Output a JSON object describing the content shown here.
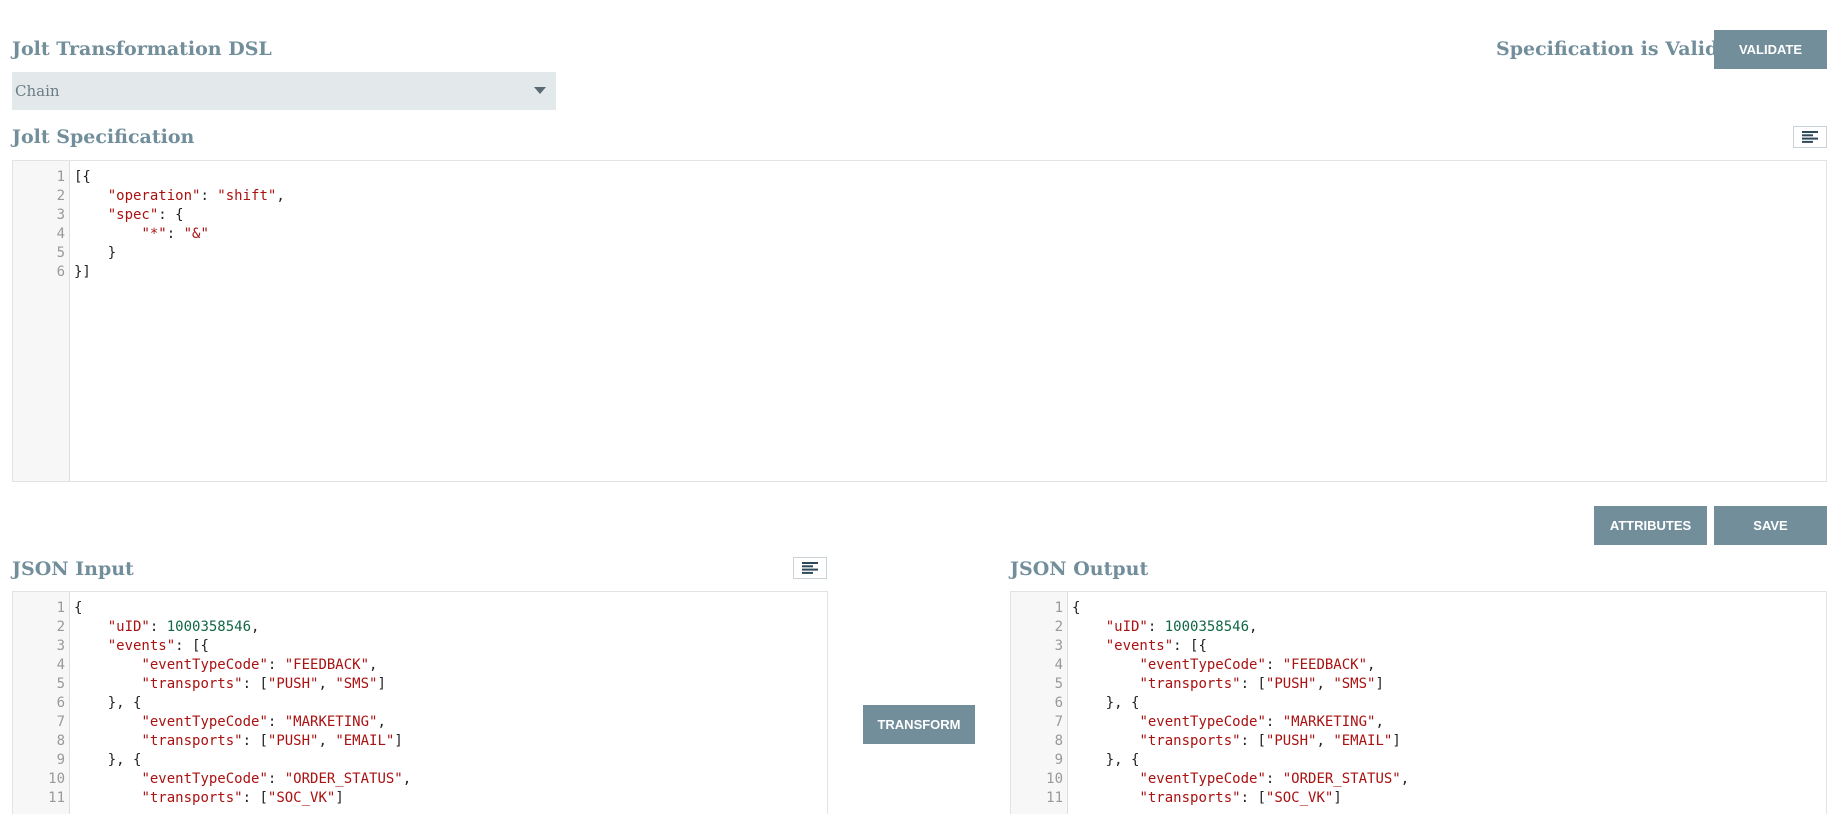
{
  "dsl": {
    "title": "Jolt Transformation DSL",
    "selected": "Chain"
  },
  "validation": {
    "status": "Specification is Valid",
    "validate_label": "VALIDATE"
  },
  "spec": {
    "title": "Jolt Specification",
    "format_icon": "format-align-icon",
    "lines": [
      [
        {
          "t": "p",
          "v": "[{"
        }
      ],
      [
        {
          "t": "p",
          "v": "    "
        },
        {
          "t": "key",
          "v": "\"operation\""
        },
        {
          "t": "p",
          "v": ": "
        },
        {
          "t": "str",
          "v": "\"shift\""
        },
        {
          "t": "p",
          "v": ","
        }
      ],
      [
        {
          "t": "p",
          "v": "    "
        },
        {
          "t": "key",
          "v": "\"spec\""
        },
        {
          "t": "p",
          "v": ": {"
        }
      ],
      [
        {
          "t": "p",
          "v": "        "
        },
        {
          "t": "key",
          "v": "\"*\""
        },
        {
          "t": "p",
          "v": ": "
        },
        {
          "t": "str",
          "v": "\"&\""
        }
      ],
      [
        {
          "t": "p",
          "v": "    }"
        }
      ],
      [
        {
          "t": "p",
          "v": "}]"
        }
      ]
    ]
  },
  "actions": {
    "attributes_label": "ATTRIBUTES",
    "save_label": "SAVE",
    "transform_label": "TRANSFORM"
  },
  "input": {
    "title": "JSON Input",
    "format_icon": "format-align-icon",
    "lines": [
      [
        {
          "t": "p",
          "v": "{"
        }
      ],
      [
        {
          "t": "p",
          "v": "    "
        },
        {
          "t": "key",
          "v": "\"uID\""
        },
        {
          "t": "p",
          "v": ": "
        },
        {
          "t": "num",
          "v": "1000358546"
        },
        {
          "t": "p",
          "v": ","
        }
      ],
      [
        {
          "t": "p",
          "v": "    "
        },
        {
          "t": "key",
          "v": "\"events\""
        },
        {
          "t": "p",
          "v": ": [{"
        }
      ],
      [
        {
          "t": "p",
          "v": "        "
        },
        {
          "t": "key",
          "v": "\"eventTypeCode\""
        },
        {
          "t": "p",
          "v": ": "
        },
        {
          "t": "str",
          "v": "\"FEEDBACK\""
        },
        {
          "t": "p",
          "v": ","
        }
      ],
      [
        {
          "t": "p",
          "v": "        "
        },
        {
          "t": "key",
          "v": "\"transports\""
        },
        {
          "t": "p",
          "v": ": ["
        },
        {
          "t": "str",
          "v": "\"PUSH\""
        },
        {
          "t": "p",
          "v": ", "
        },
        {
          "t": "str",
          "v": "\"SMS\""
        },
        {
          "t": "p",
          "v": "]"
        }
      ],
      [
        {
          "t": "p",
          "v": "    }, {"
        }
      ],
      [
        {
          "t": "p",
          "v": "        "
        },
        {
          "t": "key",
          "v": "\"eventTypeCode\""
        },
        {
          "t": "p",
          "v": ": "
        },
        {
          "t": "str",
          "v": "\"MARKETING\""
        },
        {
          "t": "p",
          "v": ","
        }
      ],
      [
        {
          "t": "p",
          "v": "        "
        },
        {
          "t": "key",
          "v": "\"transports\""
        },
        {
          "t": "p",
          "v": ": ["
        },
        {
          "t": "str",
          "v": "\"PUSH\""
        },
        {
          "t": "p",
          "v": ", "
        },
        {
          "t": "str",
          "v": "\"EMAIL\""
        },
        {
          "t": "p",
          "v": "]"
        }
      ],
      [
        {
          "t": "p",
          "v": "    }, {"
        }
      ],
      [
        {
          "t": "p",
          "v": "        "
        },
        {
          "t": "key",
          "v": "\"eventTypeCode\""
        },
        {
          "t": "p",
          "v": ": "
        },
        {
          "t": "str",
          "v": "\"ORDER_STATUS\""
        },
        {
          "t": "p",
          "v": ","
        }
      ],
      [
        {
          "t": "p",
          "v": "        "
        },
        {
          "t": "key",
          "v": "\"transports\""
        },
        {
          "t": "p",
          "v": ": ["
        },
        {
          "t": "str",
          "v": "\"SOC_VK\""
        },
        {
          "t": "p",
          "v": "]"
        }
      ]
    ]
  },
  "output": {
    "title": "JSON Output",
    "lines": [
      [
        {
          "t": "p",
          "v": "{"
        }
      ],
      [
        {
          "t": "p",
          "v": "    "
        },
        {
          "t": "key",
          "v": "\"uID\""
        },
        {
          "t": "p",
          "v": ": "
        },
        {
          "t": "num",
          "v": "1000358546"
        },
        {
          "t": "p",
          "v": ","
        }
      ],
      [
        {
          "t": "p",
          "v": "    "
        },
        {
          "t": "key",
          "v": "\"events\""
        },
        {
          "t": "p",
          "v": ": [{"
        }
      ],
      [
        {
          "t": "p",
          "v": "        "
        },
        {
          "t": "key",
          "v": "\"eventTypeCode\""
        },
        {
          "t": "p",
          "v": ": "
        },
        {
          "t": "str",
          "v": "\"FEEDBACK\""
        },
        {
          "t": "p",
          "v": ","
        }
      ],
      [
        {
          "t": "p",
          "v": "        "
        },
        {
          "t": "key",
          "v": "\"transports\""
        },
        {
          "t": "p",
          "v": ": ["
        },
        {
          "t": "str",
          "v": "\"PUSH\""
        },
        {
          "t": "p",
          "v": ", "
        },
        {
          "t": "str",
          "v": "\"SMS\""
        },
        {
          "t": "p",
          "v": "]"
        }
      ],
      [
        {
          "t": "p",
          "v": "    }, {"
        }
      ],
      [
        {
          "t": "p",
          "v": "        "
        },
        {
          "t": "key",
          "v": "\"eventTypeCode\""
        },
        {
          "t": "p",
          "v": ": "
        },
        {
          "t": "str",
          "v": "\"MARKETING\""
        },
        {
          "t": "p",
          "v": ","
        }
      ],
      [
        {
          "t": "p",
          "v": "        "
        },
        {
          "t": "key",
          "v": "\"transports\""
        },
        {
          "t": "p",
          "v": ": ["
        },
        {
          "t": "str",
          "v": "\"PUSH\""
        },
        {
          "t": "p",
          "v": ", "
        },
        {
          "t": "str",
          "v": "\"EMAIL\""
        },
        {
          "t": "p",
          "v": "]"
        }
      ],
      [
        {
          "t": "p",
          "v": "    }, {"
        }
      ],
      [
        {
          "t": "p",
          "v": "        "
        },
        {
          "t": "key",
          "v": "\"eventTypeCode\""
        },
        {
          "t": "p",
          "v": ": "
        },
        {
          "t": "str",
          "v": "\"ORDER_STATUS\""
        },
        {
          "t": "p",
          "v": ","
        }
      ],
      [
        {
          "t": "p",
          "v": "        "
        },
        {
          "t": "key",
          "v": "\"transports\""
        },
        {
          "t": "p",
          "v": ": ["
        },
        {
          "t": "str",
          "v": "\"SOC_VK\""
        },
        {
          "t": "p",
          "v": "]"
        }
      ]
    ]
  },
  "colors": {
    "accent": "#728e9b",
    "select_bg": "#e3e8eb",
    "key": "#aa1111",
    "string": "#aa1111",
    "number": "#116644"
  }
}
